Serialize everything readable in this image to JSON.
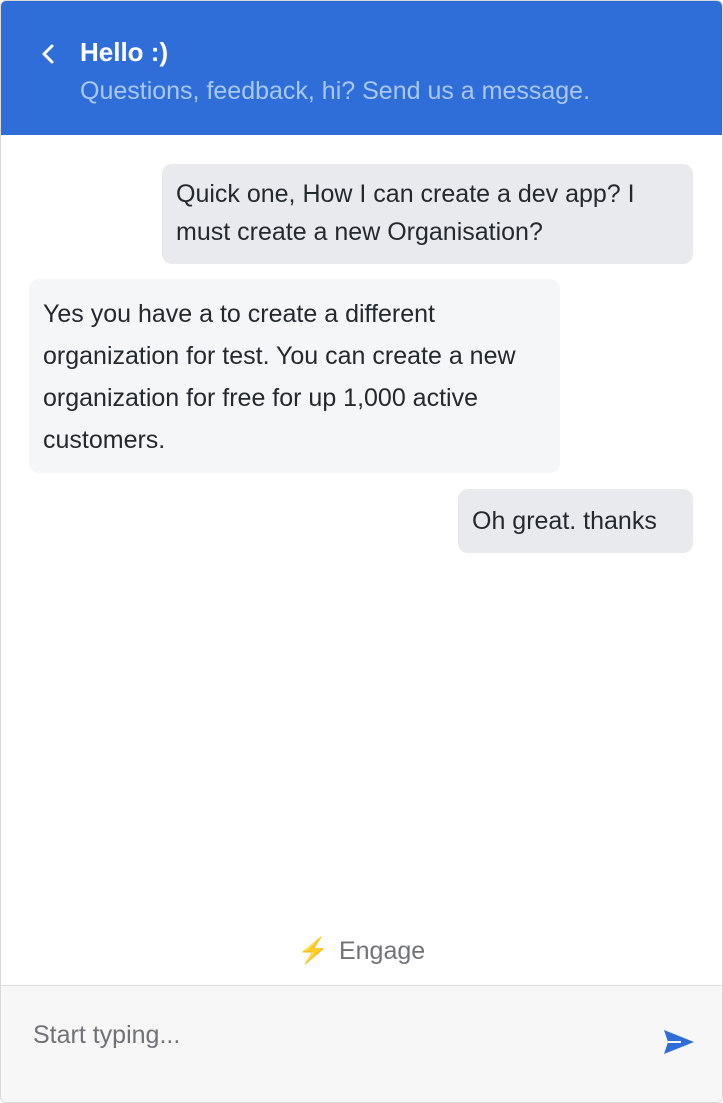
{
  "header": {
    "title": "Hello :)",
    "subtitle": "Questions, feedback, hi? Send us a message.",
    "back_icon": "chevron-left-icon",
    "background": "#2f6ed8"
  },
  "messages": [
    {
      "sender": "user",
      "text": "Quick one, How I can create a dev app? I must create a new Organisation?"
    },
    {
      "sender": "agent",
      "text": "Yes you have a to create a different organization for test. You can create a new organization for free for up 1,000 active customers."
    },
    {
      "sender": "user",
      "text": "Oh great. thanks"
    }
  ],
  "branding": {
    "icon": "lightning-bolt-icon",
    "label": "Engage",
    "icon_color": "#f3b92a"
  },
  "composer": {
    "placeholder": "Start typing...",
    "value": "",
    "send_icon": "send-icon",
    "accent": "#2f6ed8"
  }
}
